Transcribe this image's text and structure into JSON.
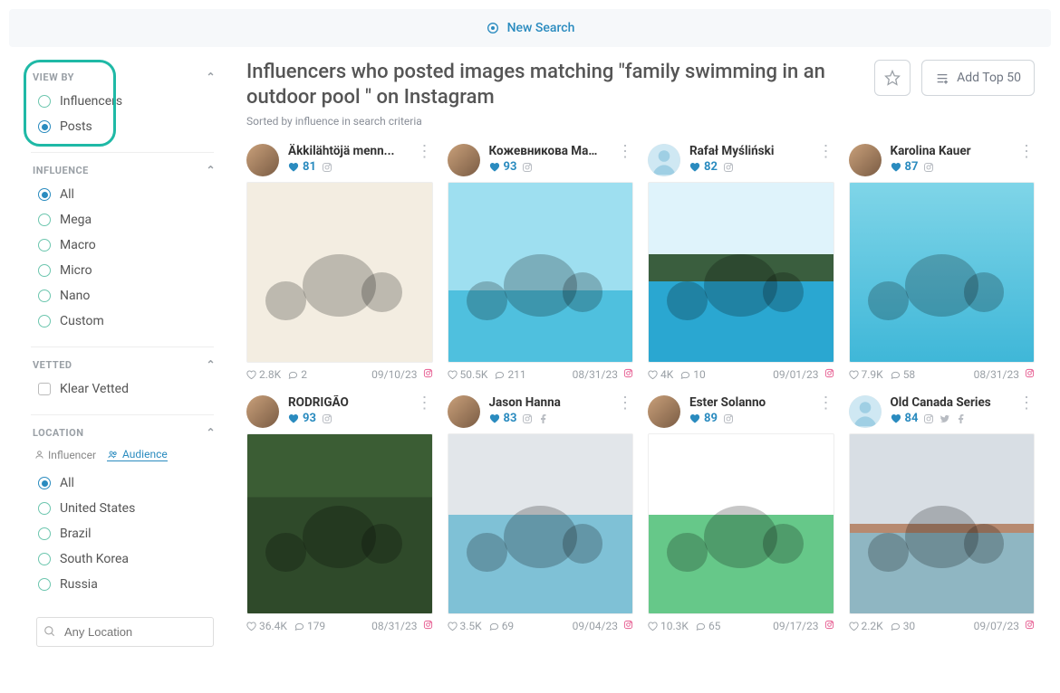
{
  "topbar": {
    "new_search": "New Search"
  },
  "sidebar": {
    "view_by": {
      "label": "VIEW BY",
      "options": [
        "Influencers",
        "Posts"
      ],
      "selected": "Posts"
    },
    "influence": {
      "label": "INFLUENCE",
      "options": [
        "All",
        "Mega",
        "Macro",
        "Micro",
        "Nano",
        "Custom"
      ],
      "selected": "All"
    },
    "vetted": {
      "label": "VETTED",
      "option": "Klear Vetted",
      "checked": false
    },
    "location": {
      "label": "LOCATION",
      "tabs": {
        "influencer": "Influencer",
        "audience": "Audience",
        "active": "Audience"
      },
      "options": [
        "All",
        "United States",
        "Brazil",
        "South Korea",
        "Russia"
      ],
      "selected": "All",
      "placeholder": "Any Location"
    }
  },
  "header": {
    "title": "Influencers who posted images matching \"family swimming in an outdoor pool \" on Instagram",
    "sorted": "Sorted by influence in search criteria",
    "add_top": "Add Top 50"
  },
  "posts": [
    {
      "name": "Äkkilähtöjä menn...",
      "score": 81,
      "socials": [
        "instagram"
      ],
      "likes": "2.8K",
      "comments": "2",
      "date": "09/10/23",
      "avatar": "img",
      "thumb": "sepia"
    },
    {
      "name": "Кожевникова Ма...",
      "score": 93,
      "socials": [
        "instagram"
      ],
      "likes": "50.5K",
      "comments": "211",
      "date": "08/31/23",
      "avatar": "img",
      "thumb": "pool"
    },
    {
      "name": "Rafał Myśliński",
      "score": 82,
      "socials": [
        "instagram"
      ],
      "likes": "4K",
      "comments": "10",
      "date": "09/01/23",
      "avatar": "ph",
      "thumb": "lake"
    },
    {
      "name": "Karolina Kauer",
      "score": 87,
      "socials": [
        "instagram"
      ],
      "likes": "7.9K",
      "comments": "58",
      "date": "08/31/23",
      "avatar": "img",
      "thumb": "clear"
    },
    {
      "name": "RODRIGÃO",
      "score": 93,
      "socials": [
        "instagram"
      ],
      "likes": "36.4K",
      "comments": "179",
      "date": "08/31/23",
      "avatar": "img",
      "thumb": "green"
    },
    {
      "name": "Jason Hanna",
      "score": 83,
      "socials": [
        "instagram",
        "facebook"
      ],
      "likes": "3.5K",
      "comments": "69",
      "date": "09/04/23",
      "avatar": "img",
      "thumb": "indoor"
    },
    {
      "name": "Ester Solanno",
      "score": 89,
      "socials": [
        "instagram"
      ],
      "likes": "10.3K",
      "comments": "65",
      "date": "09/17/23",
      "avatar": "img",
      "thumb": "family"
    },
    {
      "name": "Old Canada Series",
      "score": 84,
      "socials": [
        "instagram",
        "twitter",
        "facebook"
      ],
      "likes": "2.2K",
      "comments": "30",
      "date": "09/07/23",
      "avatar": "ph",
      "thumb": "mountain"
    }
  ]
}
